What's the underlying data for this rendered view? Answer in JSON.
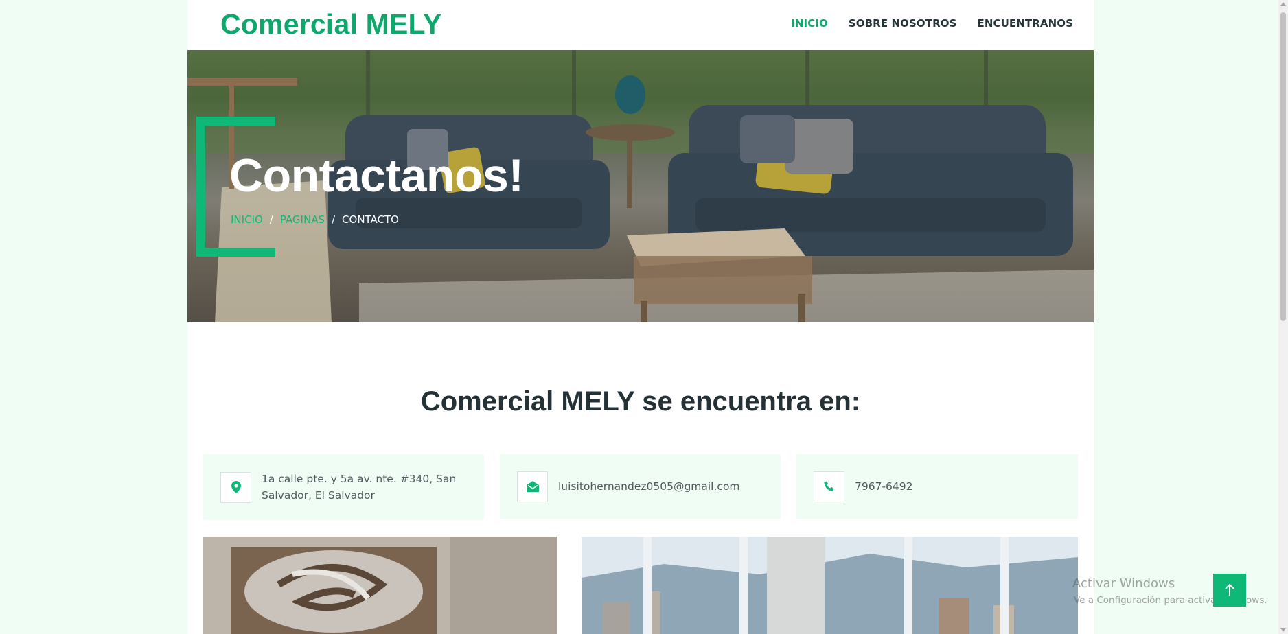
{
  "navbar": {
    "brand": "Comercial MELY",
    "links": [
      {
        "label": "INICIO",
        "active": true
      },
      {
        "label": "SOBRE NOSOTROS",
        "active": false
      },
      {
        "label": "ENCUENTRANOS",
        "active": false
      }
    ]
  },
  "hero": {
    "title": "Contactanos!",
    "breadcrumb": [
      "INICIO",
      "PAGINAS",
      "CONTACTO"
    ],
    "separator": "/"
  },
  "section": {
    "title": "Comercial MELY se encuentra en:"
  },
  "contact_cards": [
    {
      "icon": "map-marker-icon",
      "text": "1a calle pte. y 5a av. nte. #340, San Salvador, El Salvador"
    },
    {
      "icon": "envelope-open-icon",
      "text": "luisitohernandez0505@gmail.com"
    },
    {
      "icon": "phone-icon",
      "text": "7967-6492"
    }
  ],
  "gallery": [
    {
      "icon": "wall-art-image"
    },
    {
      "icon": "city-window-image"
    }
  ],
  "back_to_top": {
    "icon": "arrow-up-icon"
  },
  "watermark": {
    "title": "Activar Windows",
    "subtitle": "Ve a Configuración para activar Windows."
  },
  "colors": {
    "accent": "#0fb877",
    "brand": "#0fa86c",
    "page_bg": "#effdf5",
    "text_dark": "#243238"
  }
}
